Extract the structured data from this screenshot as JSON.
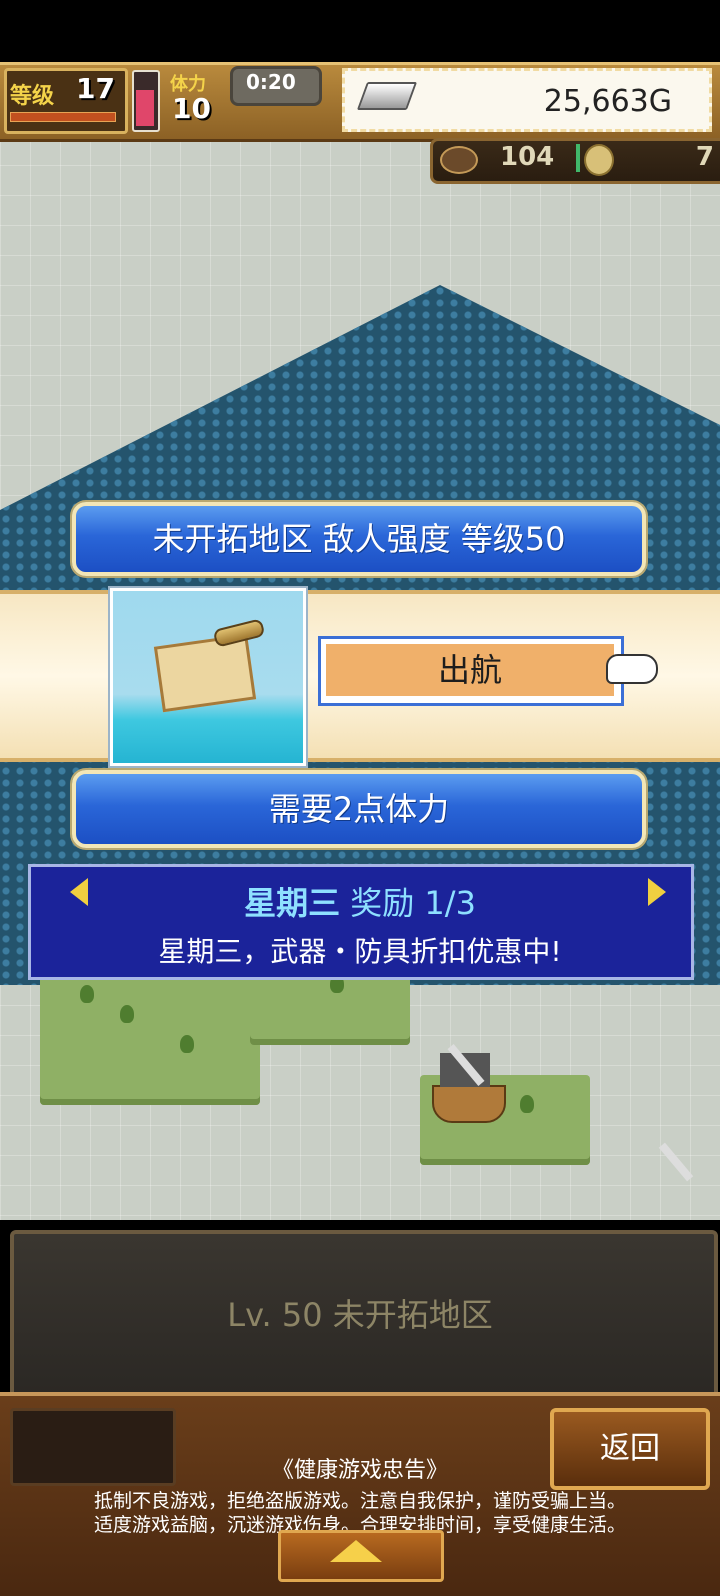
{
  "hud": {
    "level_label": "等级",
    "level_value": "17",
    "stamina_label": "体力",
    "stamina_value": "10",
    "timer": "0:20",
    "gold": "25,663G",
    "resource_1": "104",
    "resource_2": "7"
  },
  "dialog": {
    "title": "未开拓地区  敌人强度 等级50",
    "sail_button": "出航",
    "stamina_required": "需要2点体力"
  },
  "bonus": {
    "day": "星期三",
    "reward_label": "奖励 1/3",
    "text": "星期三，武器・防具折扣优惠中!"
  },
  "info": {
    "text": "Lv. 50 未开拓地区"
  },
  "bottom": {
    "back_label": "返回",
    "notice_title": "《健康游戏忠告》",
    "notice_line1": "抵制不良游戏，拒绝盗版游戏。注意自我保护，谨防受骗上当。",
    "notice_line2": "适度游戏益脑，沉迷游戏伤身。合理安排时间，享受健康生活。"
  },
  "icons": [
    "silver-bar-icon",
    "wood-log-icon",
    "gold-coin-icon",
    "spyglass-icon",
    "treasure-map-icon",
    "pointing-hand-icon",
    "sword-icon",
    "ship-icon",
    "arrow-left-icon",
    "arrow-right-icon",
    "arrow-up-icon"
  ],
  "colors": {
    "banner_blue": "#2a66d8",
    "sail_button": "#f0b06a",
    "bonus_panel": "#1b239a",
    "bonus_highlight": "#8ee0ff"
  }
}
